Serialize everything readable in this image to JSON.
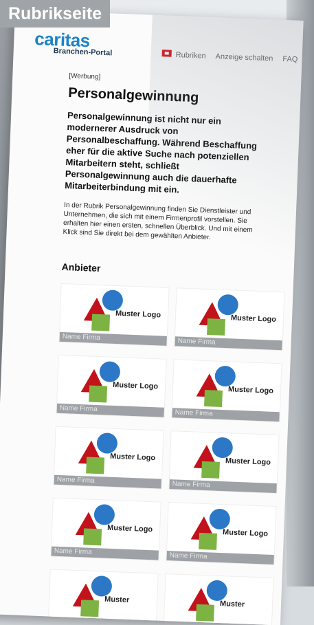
{
  "tag": "Rubrikseite",
  "header": {
    "logo": "caritas",
    "logo_sub": "Branchen-Portal",
    "nav": [
      "Rubriken",
      "Anzeige schalten",
      "FAQ"
    ]
  },
  "main": {
    "ad_label": "[Werbung]",
    "title": "Personalgewinnung",
    "lead": "Personalgewinnung ist nicht nur ein modernerer Ausdruck von Personalbeschaffung. Während Beschaffung eher für die aktive Suche nach potenziellen Mitarbeitern steht, schließt Personalgewinnung auch die dauerhafte Mitarbeiterbindung mit ein.",
    "body": "In der Rubrik Personalgewinnung finden Sie Dienstleister und Unternehmen, die sich mit einem Firmenprofil vorstellen. Sie erhalten hier einen ersten, schnellen Überblick. Und mit einem Klick sind Sie direkt bei dem gewählten Anbieter.",
    "section_title": "Anbieter",
    "providers": [
      {
        "logo_text": "Muster Logo",
        "name": "Name Firma"
      },
      {
        "logo_text": "Muster Logo",
        "name": "Name Firma"
      },
      {
        "logo_text": "Muster Logo",
        "name": "Name Firma"
      },
      {
        "logo_text": "Muster Logo",
        "name": "Name Firma"
      },
      {
        "logo_text": "Muster Logo",
        "name": "Name Firma"
      },
      {
        "logo_text": "Muster Logo",
        "name": "Name Firma"
      },
      {
        "logo_text": "Muster Logo",
        "name": "Name Firma"
      },
      {
        "logo_text": "Muster Logo",
        "name": "Name Firma"
      },
      {
        "logo_text": "Muster",
        "name": ""
      },
      {
        "logo_text": "Muster",
        "name": ""
      }
    ]
  },
  "colors": {
    "brand_blue": "#1d83c6",
    "accent_red": "#c2121b",
    "shape_blue": "#2c78c6",
    "shape_green": "#7cb342",
    "tag_gray": "#9fa4a8"
  }
}
